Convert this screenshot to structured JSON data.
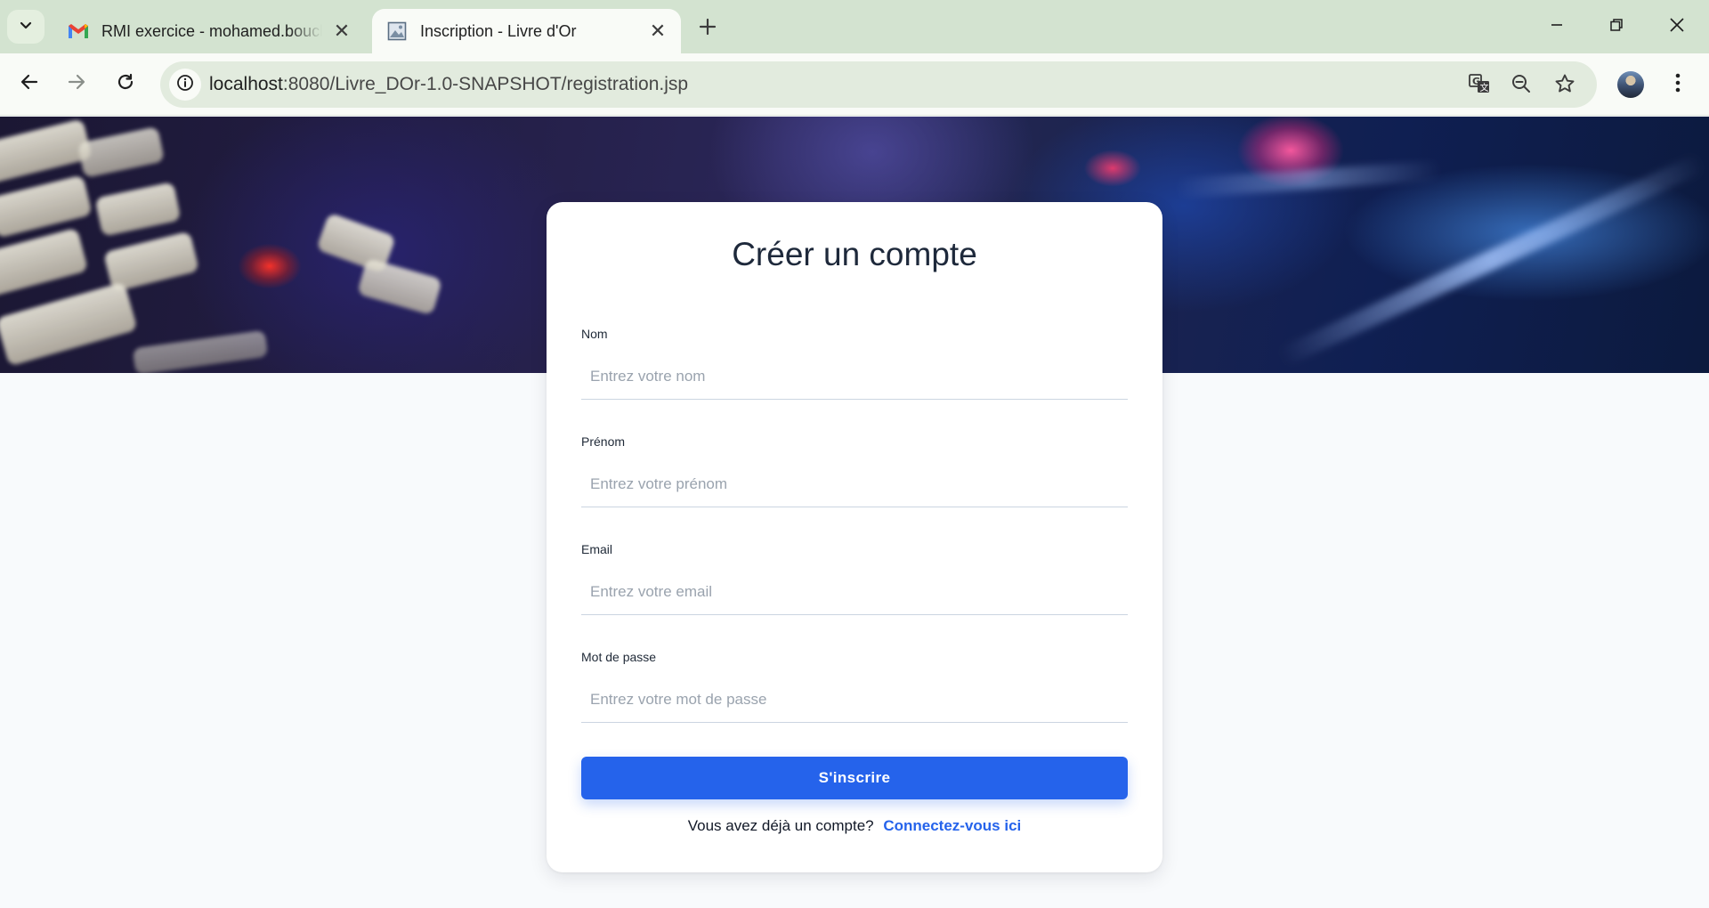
{
  "browser": {
    "tabs": [
      {
        "title": "RMI exercice - mohamed.bouch",
        "active": false,
        "favicon": "gmail-icon"
      },
      {
        "title": "Inscription - Livre d'Or",
        "active": true,
        "favicon": "page-icon"
      }
    ],
    "url_host": "localhost",
    "url_rest": ":8080/Livre_DOr-1.0-SNAPSHOT/registration.jsp"
  },
  "form": {
    "title": "Créer un compte",
    "fields": [
      {
        "label": "Nom",
        "placeholder": "Entrez votre nom"
      },
      {
        "label": "Prénom",
        "placeholder": "Entrez votre prénom"
      },
      {
        "label": "Email",
        "placeholder": "Entrez votre email"
      },
      {
        "label": "Mot de passe",
        "placeholder": "Entrez votre mot de passe"
      }
    ],
    "submit_label": "S'inscrire",
    "login_prompt": "Vous avez déjà un compte?",
    "login_link": "Connectez-vous ici"
  },
  "colors": {
    "accent": "#2563eb",
    "page_background": "#f8fafc",
    "tabstrip": "#d3e3d0"
  }
}
